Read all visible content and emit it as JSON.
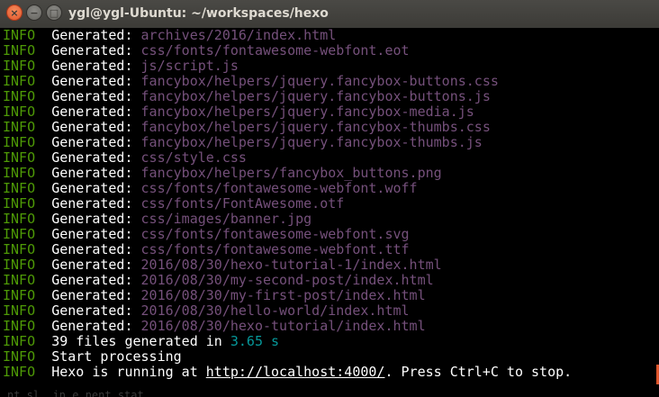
{
  "window": {
    "title": "ygl@ygl-Ubuntu: ~/workspaces/hexo",
    "close_glyph": "×",
    "minimize_glyph": "−",
    "maximize_glyph": "□"
  },
  "colors": {
    "level": "#4e9a06",
    "path": "#75507b",
    "time": "#06989a",
    "text": "#ffffff",
    "background": "#000000",
    "close_button": "#e0562c"
  },
  "log": [
    {
      "level": "INFO",
      "msg": "Generated: ",
      "path": "archives/2016/index.html"
    },
    {
      "level": "INFO",
      "msg": "Generated: ",
      "path": "css/fonts/fontawesome-webfont.eot"
    },
    {
      "level": "INFO",
      "msg": "Generated: ",
      "path": "js/script.js"
    },
    {
      "level": "INFO",
      "msg": "Generated: ",
      "path": "fancybox/helpers/jquery.fancybox-buttons.css"
    },
    {
      "level": "INFO",
      "msg": "Generated: ",
      "path": "fancybox/helpers/jquery.fancybox-buttons.js"
    },
    {
      "level": "INFO",
      "msg": "Generated: ",
      "path": "fancybox/helpers/jquery.fancybox-media.js"
    },
    {
      "level": "INFO",
      "msg": "Generated: ",
      "path": "fancybox/helpers/jquery.fancybox-thumbs.css"
    },
    {
      "level": "INFO",
      "msg": "Generated: ",
      "path": "fancybox/helpers/jquery.fancybox-thumbs.js"
    },
    {
      "level": "INFO",
      "msg": "Generated: ",
      "path": "css/style.css"
    },
    {
      "level": "INFO",
      "msg": "Generated: ",
      "path": "fancybox/helpers/fancybox_buttons.png"
    },
    {
      "level": "INFO",
      "msg": "Generated: ",
      "path": "css/fonts/fontawesome-webfont.woff"
    },
    {
      "level": "INFO",
      "msg": "Generated: ",
      "path": "css/fonts/FontAwesome.otf"
    },
    {
      "level": "INFO",
      "msg": "Generated: ",
      "path": "css/images/banner.jpg"
    },
    {
      "level": "INFO",
      "msg": "Generated: ",
      "path": "css/fonts/fontawesome-webfont.svg"
    },
    {
      "level": "INFO",
      "msg": "Generated: ",
      "path": "css/fonts/fontawesome-webfont.ttf"
    },
    {
      "level": "INFO",
      "msg": "Generated: ",
      "path": "2016/08/30/hexo-tutorial-1/index.html"
    },
    {
      "level": "INFO",
      "msg": "Generated: ",
      "path": "2016/08/30/my-second-post/index.html"
    },
    {
      "level": "INFO",
      "msg": "Generated: ",
      "path": "2016/08/30/my-first-post/index.html"
    },
    {
      "level": "INFO",
      "msg": "Generated: ",
      "path": "2016/08/30/hello-world/index.html"
    },
    {
      "level": "INFO",
      "msg": "Generated: ",
      "path": "2016/08/30/hexo-tutorial/index.html"
    }
  ],
  "summary": {
    "level": "INFO",
    "text": "39 files generated in ",
    "time": "3.65 s"
  },
  "processing": {
    "level": "INFO",
    "text": "Start processing"
  },
  "server": {
    "level": "INFO",
    "prefix": "Hexo is running at ",
    "url": "http://localhost:4000/",
    "suffix": ". Press Ctrl+C to stop."
  },
  "partial_line": "nt sl_ in.e_nent_stat"
}
